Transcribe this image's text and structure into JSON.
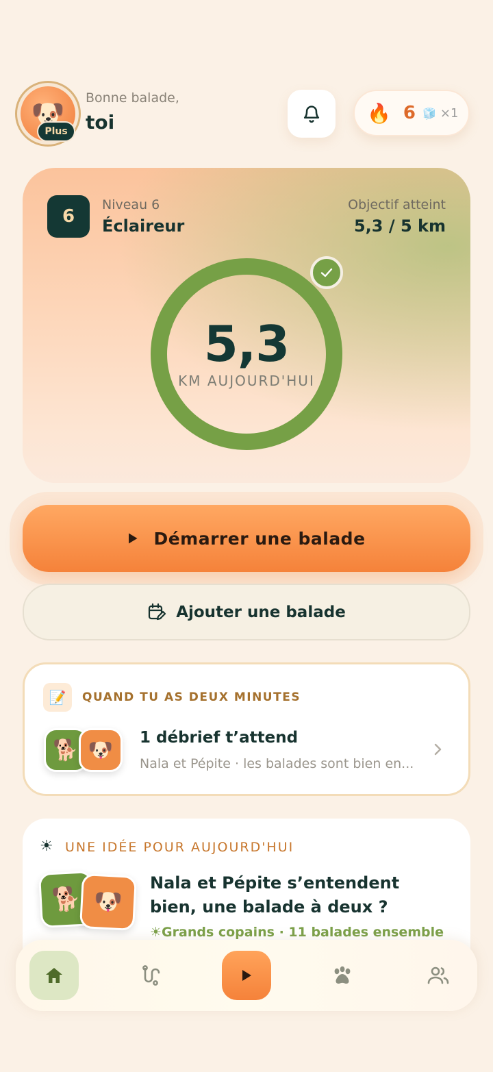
{
  "header": {
    "greeting": "Bonne balade,",
    "user_name": "toi",
    "avatar_emoji": "🐶",
    "plan_badge": "Plus",
    "streak_icon": "🔥",
    "streak_count": "6",
    "freeze_icon": "🧊",
    "freeze_count": "×1"
  },
  "level_card": {
    "level_number": "6",
    "level_label": "Niveau 6",
    "level_title": "Éclaireur",
    "goal_label": "Objectif atteint",
    "goal_value": "5,3 / 5 km",
    "distance_value": "5,3",
    "distance_unit": "KM AUJOURD'HUI",
    "goal_progress": 1.0
  },
  "actions": {
    "start_label": "Démarrer une balade",
    "add_label": "Ajouter une balade"
  },
  "debrief": {
    "kicker": "QUAND TU AS DEUX MINUTES",
    "kicker_icon": "📝",
    "title": "1 débrief t’attend",
    "subtitle": "Nala et Pépite · les balades sont bien en...",
    "pet1_emoji": "🐕",
    "pet2_emoji": "🐶"
  },
  "idea": {
    "kicker_icon": "☀",
    "kicker": "UNE IDÉE POUR AUJOURD'HUI",
    "title": "Nala et Pépite s’entendent bien, une balade à deux ?",
    "subtitle": "☀Grands copains · 11 balades ensemble",
    "pet1_emoji": "🐕",
    "pet2_emoji": "🐶"
  },
  "nav": {
    "items": [
      "home-icon",
      "routes-icon",
      "play-icon",
      "paw-icon",
      "friends-icon"
    ],
    "active": "home"
  },
  "colors": {
    "accent_orange": "#f5823a",
    "accent_green": "#76a046",
    "dark_teal": "#143834",
    "background": "#fbf1e6"
  }
}
